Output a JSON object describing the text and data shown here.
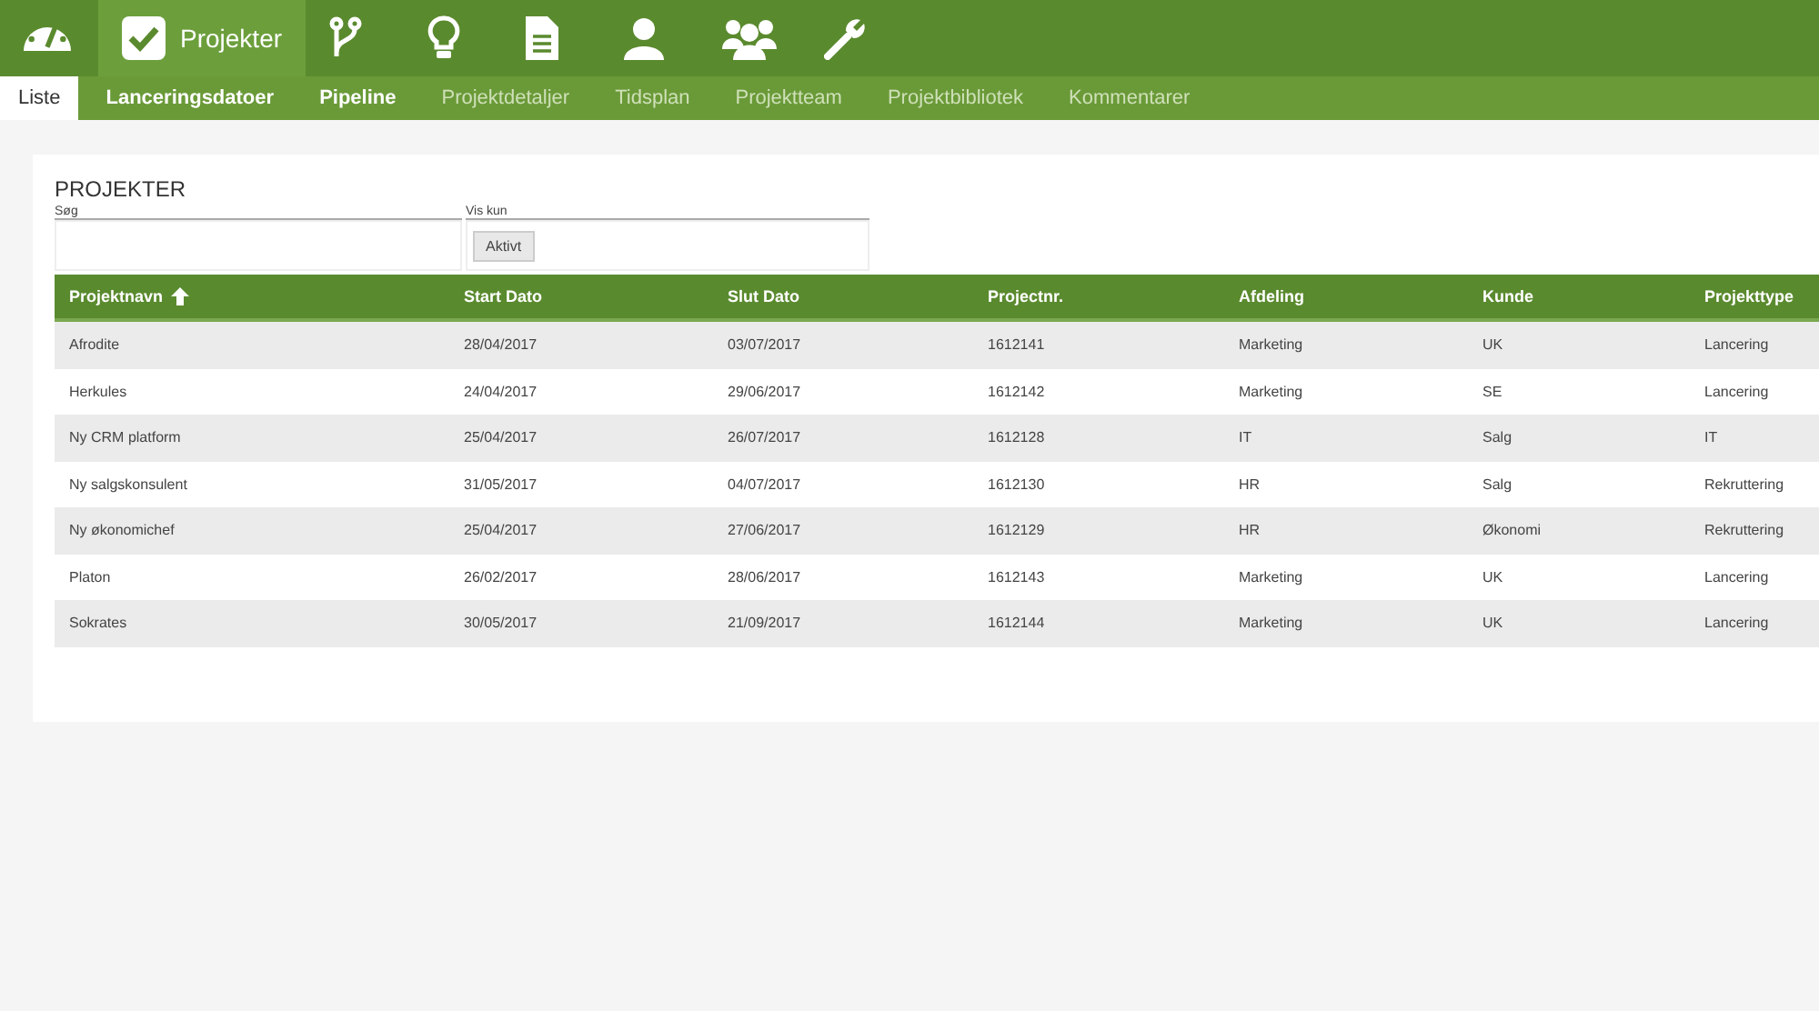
{
  "top_nav": [
    {
      "selected": false
    },
    {
      "label": "Projekter",
      "selected": true
    },
    {
      "selected": false
    },
    {
      "selected": false
    },
    {
      "selected": false
    },
    {
      "selected": false
    },
    {
      "selected": false
    },
    {
      "selected": false
    }
  ],
  "tabs": [
    {
      "label": "Liste",
      "selected": true,
      "disabled": false
    },
    {
      "label": "Lanceringsdatoer",
      "selected": false,
      "disabled": false
    },
    {
      "label": "Pipeline",
      "selected": false,
      "disabled": false
    },
    {
      "label": "Projektdetaljer",
      "selected": false,
      "disabled": true
    },
    {
      "label": "Tidsplan",
      "selected": false,
      "disabled": true
    },
    {
      "label": "Projektteam",
      "selected": false,
      "disabled": true
    },
    {
      "label": "Projektbibliotek",
      "selected": false,
      "disabled": true
    },
    {
      "label": "Kommentarer",
      "selected": false,
      "disabled": true
    }
  ],
  "title": "PROJEKTER",
  "search": {
    "label": "Søg"
  },
  "filter": {
    "label": "Vis kun",
    "chip": "Aktivt"
  },
  "table": {
    "columns": [
      {
        "label": "Projektnavn",
        "sorted": true
      },
      {
        "label": "Start Dato",
        "sorted": false
      },
      {
        "label": "Slut Dato",
        "sorted": false
      },
      {
        "label": "Projectnr.",
        "sorted": false
      },
      {
        "label": "Afdeling",
        "sorted": false
      },
      {
        "label": "Kunde",
        "sorted": false
      },
      {
        "label": "Projekttype",
        "sorted": false
      }
    ],
    "rows": [
      [
        "Afrodite",
        "28/04/2017",
        "03/07/2017",
        "1612141",
        "Marketing",
        "UK",
        "Lancering"
      ],
      [
        "Herkules",
        "24/04/2017",
        "29/06/2017",
        "1612142",
        "Marketing",
        "SE",
        "Lancering"
      ],
      [
        "Ny CRM platform",
        "25/04/2017",
        "26/07/2017",
        "1612128",
        "IT",
        "Salg",
        "IT"
      ],
      [
        "Ny salgskonsulent",
        "31/05/2017",
        "04/07/2017",
        "1612130",
        "HR",
        "Salg",
        "Rekruttering"
      ],
      [
        "Ny økonomichef",
        "25/04/2017",
        "27/06/2017",
        "1612129",
        "HR",
        "Økonomi",
        "Rekruttering"
      ],
      [
        "Platon",
        "26/02/2017",
        "28/06/2017",
        "1612143",
        "Marketing",
        "UK",
        "Lancering"
      ],
      [
        "Sokrates",
        "30/05/2017",
        "21/09/2017",
        "1612144",
        "Marketing",
        "UK",
        "Lancering"
      ]
    ]
  }
}
